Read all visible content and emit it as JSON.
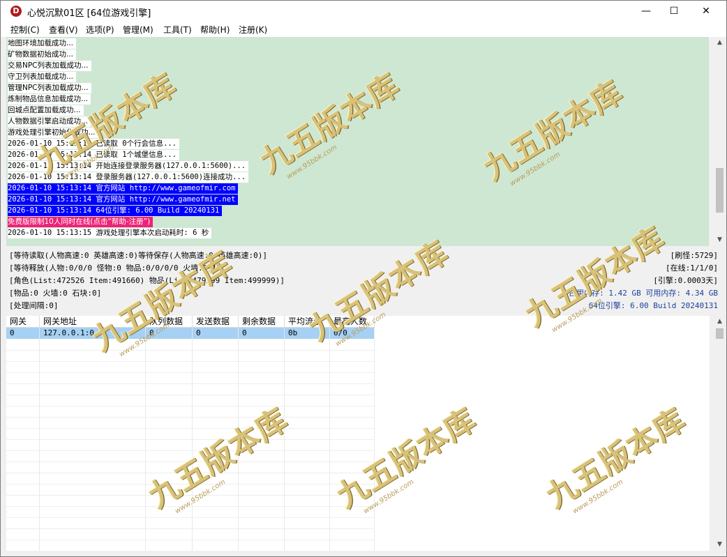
{
  "window": {
    "title": "心悦沉默01区 [64位游戏引擎]",
    "icon_letter": "D",
    "minimize": "—",
    "maximize": "☐",
    "close": "✕"
  },
  "menu": [
    "控制(C)",
    "查看(V)",
    "选项(P)",
    "管理(M)",
    "工具(T)",
    "帮助(H)",
    "注册(K)"
  ],
  "log": [
    {
      "text": "地图环境加载成功...",
      "style": "cjk"
    },
    {
      "text": "矿物数据初始成功...",
      "style": "cjk"
    },
    {
      "text": "交易NPC列表加载成功...",
      "style": "cjk"
    },
    {
      "text": "守卫列表加载成功...",
      "style": "cjk"
    },
    {
      "text": "管理NPC列表加载成功...",
      "style": "cjk"
    },
    {
      "text": "炼制物品信息加载成功...",
      "style": "cjk"
    },
    {
      "text": "回城点配置加载成功...",
      "style": "cjk"
    },
    {
      "text": "人物数据引擎启动成功...",
      "style": "cjk"
    },
    {
      "text": "游戏处理引擎初始化成功...",
      "style": "cjk"
    },
    {
      "text": "2026-01-10 15:13:14 已读取 0个行会信息...",
      "style": ""
    },
    {
      "text": "2026-01-10 15:13:14 已读取 1个城堡信息...",
      "style": ""
    },
    {
      "text": "2026-01-10 15:13:14 开始连接登录服务器(127.0.0.1:5600)...",
      "style": ""
    },
    {
      "text": "2026-01-10 15:13:14 登录服务器(127.0.0.1:5600)连接成功...",
      "style": ""
    },
    {
      "text": "2026-01-10 15:13:14 官方网站 http://www.gameofmir.com",
      "style": "hl"
    },
    {
      "text": "2026-01-10 15:13:14 官方网站 http://www.gameofmir.net",
      "style": "hl"
    },
    {
      "text": "2026-01-10 15:13:14 64位引擎: 6.00 Build 20240131",
      "style": "hl"
    },
    {
      "text": "免费版限制10人同时在线(点击“帮助-注册”)",
      "style": "pink"
    },
    {
      "text": "2026-01-10 15:13:15 游戏处理引擎本次启动耗时: 6 秒",
      "style": ""
    }
  ],
  "status": {
    "waiting_read": "[等待读取(人物高速:0 英雄高速:0)等待保存(人物高速:0 英雄高速:0)]",
    "waiting_release": "[等待释放(人物:0/0/0 怪物:0 物品:0/0/0/0 火墙:0)]",
    "roles": "[角色(List:472526 Item:491660) 物品(List:479999 Item:499999)]",
    "items": "[物品:0 火墙:0 石块:0]",
    "interval": "[处理间隔:0]",
    "monsters": "[刷怪:5729]",
    "online": "[在线:1/1/0]",
    "engine_time": "[引擎:0.0003天]",
    "memory": "占用内存: 1.42 GB 可用内存: 4.34 GB",
    "engine_version": "64位引擎: 6.00 Build 20240131"
  },
  "grid": {
    "columns": [
      "网关",
      "网关地址",
      "队列数据",
      "发送数据",
      "剩余数据",
      "平均流量",
      "最高人数"
    ],
    "rows": [
      [
        "0",
        "127.0.0.1:0",
        "0",
        "0",
        "0",
        "0b",
        "0/0"
      ]
    ]
  },
  "watermark": {
    "main": "九五版本库",
    "sub": "www.95bbk.com"
  },
  "colors": {
    "log_bg": "#cde7d2",
    "highlight": "#0000ff",
    "pink": "#ee2277",
    "selected_row": "#a6d0f4"
  }
}
